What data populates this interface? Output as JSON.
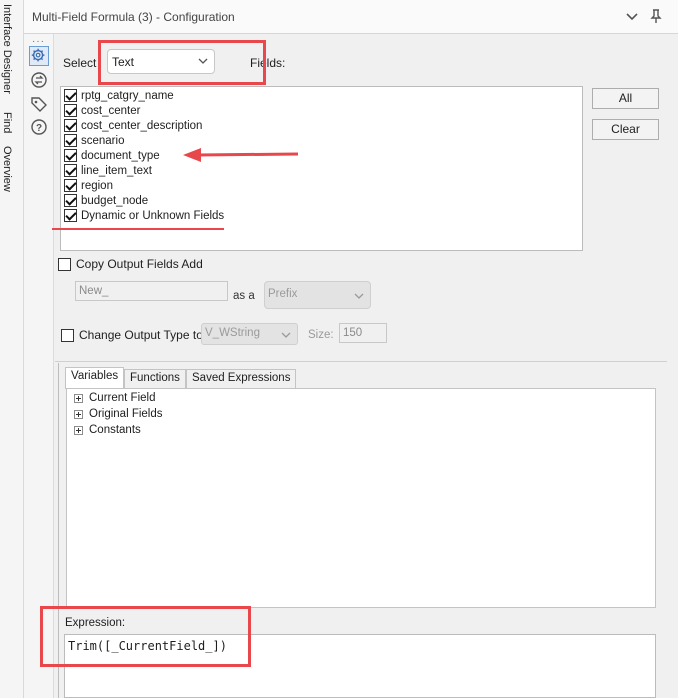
{
  "side_tabs": [
    "Interface Designer",
    "Find",
    "Overview"
  ],
  "window": {
    "title": "Multi-Field Formula (3) - Configuration"
  },
  "sidebar_icons": [
    "gear-icon",
    "connection-icon",
    "tag-icon",
    "help-icon"
  ],
  "select": {
    "label": "Select",
    "value": "Text",
    "fields_label": "Fields:"
  },
  "fields": [
    {
      "label": "rptg_catgry_name",
      "checked": true
    },
    {
      "label": "cost_center",
      "checked": true
    },
    {
      "label": "cost_center_description",
      "checked": true
    },
    {
      "label": "scenario",
      "checked": true
    },
    {
      "label": "document_type",
      "checked": true
    },
    {
      "label": "line_item_text",
      "checked": true
    },
    {
      "label": "region",
      "checked": true
    },
    {
      "label": "budget_node",
      "checked": true
    },
    {
      "label": "Dynamic or Unknown Fields",
      "checked": true
    }
  ],
  "buttons": {
    "all": "All",
    "clear": "Clear"
  },
  "copy_output": {
    "label": "Copy Output Fields Add",
    "checked": false,
    "value": "New_",
    "as_a": "as a",
    "position": "Prefix"
  },
  "change_output": {
    "label": "Change Output Type to",
    "checked": false,
    "type": "V_WString",
    "size_label": "Size:",
    "size": "150"
  },
  "tabs": [
    "Variables",
    "Functions",
    "Saved Expressions"
  ],
  "tree": [
    "Current Field",
    "Original Fields",
    "Constants"
  ],
  "expression": {
    "label": "Expression:",
    "value": "Trim([_CurrentField_])"
  },
  "colors": {
    "annotation": "#e8474b",
    "accent": "#6a9cd6"
  }
}
